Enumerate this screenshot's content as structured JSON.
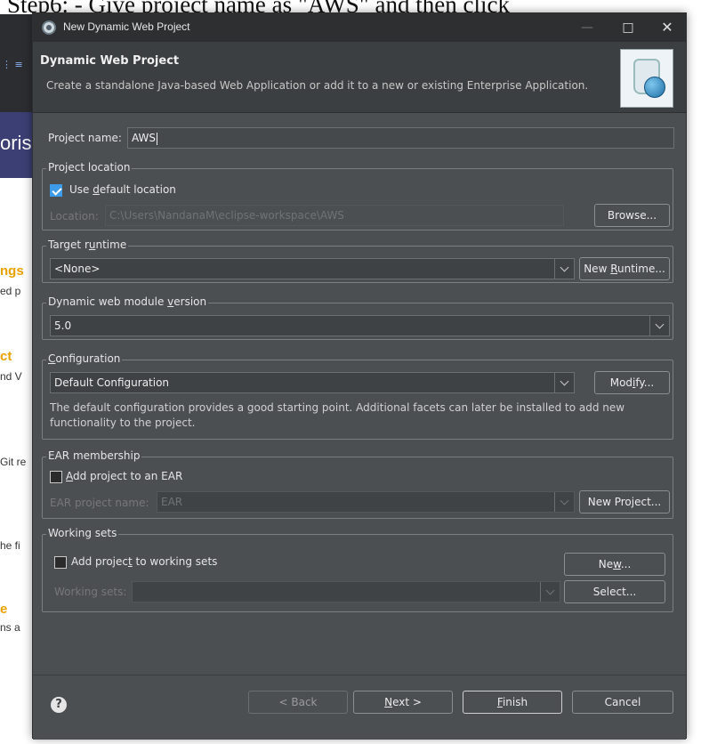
{
  "background": {
    "caption": "Step6: - Give project name as \"AWS\" and then click",
    "banner_text": "oris",
    "fragments": [
      "ngs",
      "ed p",
      "ct",
      "nd V",
      "Git re",
      "he fi",
      "e",
      "ns a"
    ]
  },
  "window": {
    "title": "New Dynamic Web Project",
    "minimize": "—",
    "maximize": "□",
    "close": "✕"
  },
  "header": {
    "title": "Dynamic Web Project",
    "description": "Create a standalone Java-based Web Application or add it to a new or existing Enterprise Application."
  },
  "form": {
    "project_name_label": "Project name:",
    "project_name_value": "AWS",
    "project_location": {
      "group_title": "Project location",
      "use_default_pre": "Use ",
      "use_default_mn": "d",
      "use_default_post": "efault location",
      "use_default_checked": true,
      "location_label": "Location:",
      "location_value": "C:\\Users\\NandanaM\\eclipse-workspace\\AWS",
      "browse": "Browse..."
    },
    "target_runtime": {
      "title_pre": "Target r",
      "title_mn": "u",
      "title_post": "ntime",
      "value": "<None>",
      "new_runtime_pre": "New ",
      "new_runtime_mn": "R",
      "new_runtime_post": "untime..."
    },
    "module_version": {
      "title_pre": "Dynamic web module ",
      "title_mn": "v",
      "title_post": "ersion",
      "value": "5.0"
    },
    "configuration": {
      "title_mn": "C",
      "title_post": "onfiguration",
      "value": "Default Configuration",
      "modify_pre": "Mod",
      "modify_mn": "i",
      "modify_post": "fy...",
      "description": "The default configuration provides a good starting point. Additional facets can later be installed to add new functionality to the project."
    },
    "ear": {
      "group_title": "EAR membership",
      "checkbox_mn": "A",
      "checkbox_post": "dd project to an EAR",
      "checked": false,
      "project_name_label": "EAR project name:",
      "project_name_value": "EAR",
      "new_project": "New Project..."
    },
    "working_sets": {
      "group_title": "Working sets",
      "checkbox_pre": "Add projec",
      "checkbox_mn": "t",
      "checkbox_post": " to working sets",
      "checked": false,
      "new_pre": "Ne",
      "new_mn": "w",
      "new_post": "...",
      "label": "Working sets:",
      "value": "",
      "select": "Select..."
    }
  },
  "footer": {
    "help": "?",
    "back": "< Back",
    "next_mn": "N",
    "next_post": "ext >",
    "finish_mn": "F",
    "finish_post": "inish",
    "cancel": "Cancel"
  }
}
